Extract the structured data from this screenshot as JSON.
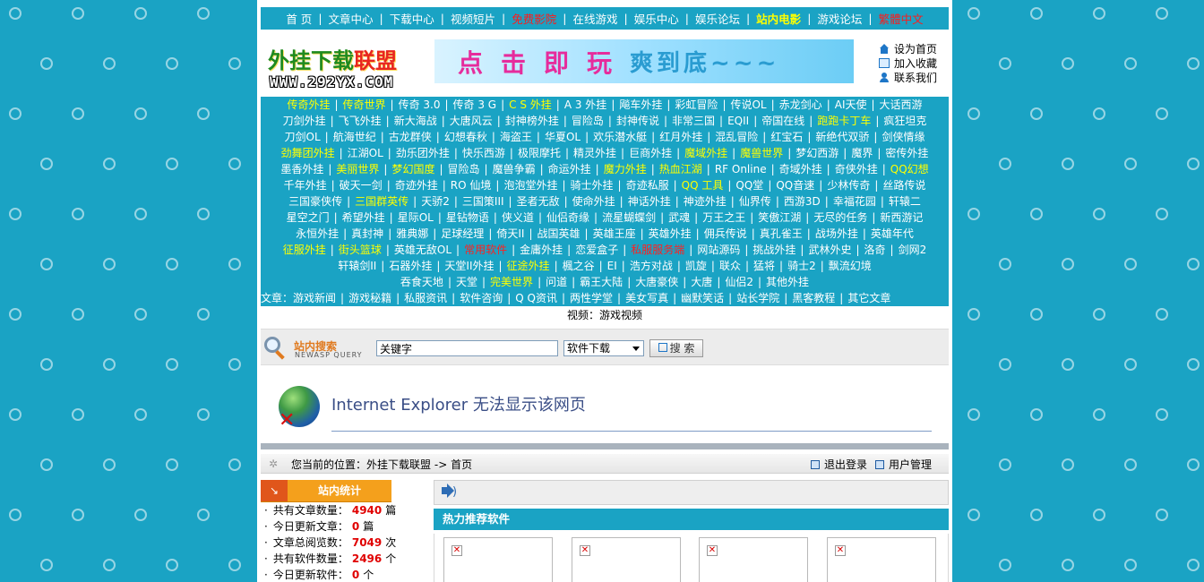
{
  "topnav": [
    {
      "label": "首 页",
      "style": "normal"
    },
    {
      "label": "文章中心",
      "style": "normal"
    },
    {
      "label": "下载中心",
      "style": "normal"
    },
    {
      "label": "视频短片",
      "style": "normal"
    },
    {
      "label": "免费影院",
      "style": "red"
    },
    {
      "label": "在线游戏",
      "style": "normal"
    },
    {
      "label": "娱乐中心",
      "style": "normal"
    },
    {
      "label": "娱乐论坛",
      "style": "normal"
    },
    {
      "label": "站内电影",
      "style": "yellow"
    },
    {
      "label": "游戏论坛",
      "style": "normal"
    },
    {
      "label": "繁體中文",
      "style": "red"
    }
  ],
  "logo": {
    "main_prefix": "外挂下载",
    "main_highlight": "联盟",
    "url_text": "WWW.292YX.COM"
  },
  "banner": {
    "text": "点击即玩",
    "tail": "爽到底~~~"
  },
  "quick_links": [
    {
      "label": "设为首页",
      "icon": "home-icon"
    },
    {
      "label": "加入收藏",
      "icon": "favorite-icon"
    },
    {
      "label": "联系我们",
      "icon": "contact-icon"
    }
  ],
  "link_rows": [
    [
      [
        "传奇外挂",
        "y"
      ],
      [
        "传奇世界",
        "y"
      ],
      [
        "传奇 3.0",
        ""
      ],
      [
        "传奇 3 G",
        ""
      ],
      [
        "C S 外挂",
        "y"
      ],
      [
        "A 3 外挂",
        ""
      ],
      [
        "飚车外挂",
        ""
      ],
      [
        "彩虹冒险",
        ""
      ],
      [
        "传说OL",
        ""
      ],
      [
        "赤龙剑心",
        ""
      ],
      [
        "AI天使",
        ""
      ],
      [
        "大话西游",
        ""
      ]
    ],
    [
      [
        "刀剑外挂",
        ""
      ],
      [
        "飞飞外挂",
        ""
      ],
      [
        "新大海战",
        ""
      ],
      [
        "大唐风云",
        ""
      ],
      [
        "封神榜外挂",
        ""
      ],
      [
        "冒险岛",
        ""
      ],
      [
        "封神传说",
        ""
      ],
      [
        "非常三国",
        ""
      ],
      [
        "EQII",
        ""
      ],
      [
        "帝国在线",
        ""
      ],
      [
        "跑跑卡丁车",
        "y"
      ],
      [
        "疯狂坦克",
        ""
      ]
    ],
    [
      [
        "刀剑OL",
        ""
      ],
      [
        "航海世纪",
        ""
      ],
      [
        "古龙群侠",
        ""
      ],
      [
        "幻想春秋",
        ""
      ],
      [
        "海盗王",
        ""
      ],
      [
        "华夏OL",
        ""
      ],
      [
        "欢乐潜水艇",
        ""
      ],
      [
        "红月外挂",
        ""
      ],
      [
        "混乱冒险",
        ""
      ],
      [
        "红宝石",
        ""
      ],
      [
        "新绝代双骄",
        ""
      ],
      [
        "剑侠情缘",
        ""
      ]
    ],
    [
      [
        "劲舞团外挂",
        "y"
      ],
      [
        "江湖OL",
        ""
      ],
      [
        "劲乐团外挂",
        ""
      ],
      [
        "快乐西游",
        ""
      ],
      [
        "极限摩托",
        ""
      ],
      [
        "精灵外挂",
        ""
      ],
      [
        "巨商外挂",
        ""
      ],
      [
        "魔域外挂",
        "y"
      ],
      [
        "魔兽世界",
        "y"
      ],
      [
        "梦幻西游",
        ""
      ],
      [
        "魔界",
        ""
      ],
      [
        "密传外挂",
        ""
      ]
    ],
    [
      [
        "墨香外挂",
        ""
      ],
      [
        "美丽世界",
        "y"
      ],
      [
        "梦幻国度",
        "y"
      ],
      [
        "冒险岛",
        ""
      ],
      [
        "魔兽争霸",
        ""
      ],
      [
        "命运外挂",
        ""
      ],
      [
        "魔力外挂",
        "y"
      ],
      [
        "热血江湖",
        "y"
      ],
      [
        "RF Online",
        ""
      ],
      [
        "奇域外挂",
        ""
      ],
      [
        "奇侠外挂",
        ""
      ],
      [
        "QQ幻想",
        "y"
      ]
    ],
    [
      [
        "千年外挂",
        ""
      ],
      [
        "破天一剑",
        ""
      ],
      [
        "奇迹外挂",
        ""
      ],
      [
        "RO 仙境",
        ""
      ],
      [
        "泡泡堂外挂",
        ""
      ],
      [
        "骑士外挂",
        ""
      ],
      [
        "奇迹私服",
        ""
      ],
      [
        "QQ 工具",
        "y"
      ],
      [
        "QQ堂",
        ""
      ],
      [
        "QQ音速",
        ""
      ],
      [
        "少林传奇",
        ""
      ],
      [
        "丝路传说",
        ""
      ]
    ],
    [
      [
        "三国豪侠传",
        ""
      ],
      [
        "三国群英传",
        "y"
      ],
      [
        "天骄2",
        ""
      ],
      [
        "三国策III",
        ""
      ],
      [
        "圣者无敌",
        ""
      ],
      [
        "使命外挂",
        ""
      ],
      [
        "神话外挂",
        ""
      ],
      [
        "神迹外挂",
        ""
      ],
      [
        "仙界传",
        ""
      ],
      [
        "西游3D",
        ""
      ],
      [
        "幸福花园",
        ""
      ],
      [
        "轩辕二",
        ""
      ]
    ],
    [
      [
        "星空之门",
        ""
      ],
      [
        "希望外挂",
        ""
      ],
      [
        "星际OL",
        ""
      ],
      [
        "星钻物语",
        ""
      ],
      [
        "侠义道",
        ""
      ],
      [
        "仙侣奇缘",
        ""
      ],
      [
        "流星蝴蝶剑",
        ""
      ],
      [
        "武魂",
        ""
      ],
      [
        "万王之王",
        ""
      ],
      [
        "笑傲江湖",
        ""
      ],
      [
        "无尽的任务",
        ""
      ],
      [
        "新西游记",
        ""
      ]
    ],
    [
      [
        "永恒外挂",
        ""
      ],
      [
        "真封神",
        ""
      ],
      [
        "雅典娜",
        ""
      ],
      [
        "足球经理",
        ""
      ],
      [
        "倚天II",
        ""
      ],
      [
        "战国英雄",
        ""
      ],
      [
        "英雄王座",
        ""
      ],
      [
        "英雄外挂",
        ""
      ],
      [
        "佣兵传说",
        ""
      ],
      [
        "真孔雀王",
        ""
      ],
      [
        "战场外挂",
        ""
      ],
      [
        "英雄年代",
        ""
      ]
    ],
    [
      [
        "征服外挂",
        "y"
      ],
      [
        "街头篮球",
        "y"
      ],
      [
        "英雄无敌OL",
        ""
      ],
      [
        "常用软件",
        "r"
      ],
      [
        "金庸外挂",
        ""
      ],
      [
        "恋爱盒子",
        ""
      ],
      [
        "私服服务端",
        "r"
      ],
      [
        "网站源码",
        ""
      ],
      [
        "挑战外挂",
        ""
      ],
      [
        "武林外史",
        ""
      ],
      [
        "洛奇",
        ""
      ],
      [
        "剑网2",
        ""
      ]
    ],
    [
      [
        "轩辕剑II",
        ""
      ],
      [
        "石器外挂",
        ""
      ],
      [
        "天堂II外挂",
        ""
      ],
      [
        "征途外挂",
        "y"
      ],
      [
        "楓之谷",
        ""
      ],
      [
        "EI",
        ""
      ],
      [
        "浩方对战",
        ""
      ],
      [
        "凯旋",
        ""
      ],
      [
        "联众",
        ""
      ],
      [
        "猛将",
        ""
      ],
      [
        "骑士2",
        ""
      ],
      [
        "飘流幻境",
        ""
      ]
    ],
    [
      [
        "吞食天地",
        ""
      ],
      [
        "天堂",
        ""
      ],
      [
        "完美世界",
        "y"
      ],
      [
        "问道",
        ""
      ],
      [
        "霸王大陆",
        ""
      ],
      [
        "大唐豪侠",
        ""
      ],
      [
        "大唐",
        ""
      ],
      [
        "仙侣2",
        ""
      ],
      [
        "其他外挂",
        ""
      ]
    ]
  ],
  "article_line": {
    "prefix": "文章：",
    "items": [
      "游戏新闻",
      "游戏秘籍",
      "私服资讯",
      "软件咨询",
      "Q Q资讯",
      "两性学堂",
      "美女写真",
      "幽默笑话",
      "站长学院",
      "黑客教程",
      "其它文章"
    ]
  },
  "video_line": {
    "prefix": "视频：",
    "item": "游戏视频"
  },
  "search": {
    "title": "站内搜索",
    "subtitle": "NEWASP QUERY",
    "keyword": "关键字",
    "category": "软件下载",
    "button": "搜 索"
  },
  "error_title": "Internet Explorer 无法显示该网页",
  "breadcrumb": {
    "prefix": "您当前的位置：",
    "site": "外挂下载联盟",
    "arrow": "->",
    "current": "首页",
    "logout": "退出登录",
    "user_manage": "用户管理"
  },
  "stats": {
    "title": "站内统计",
    "items": [
      {
        "label": "共有文章数量：",
        "value": "4940",
        "unit": "篇"
      },
      {
        "label": "今日更新文章：",
        "value": "0",
        "unit": "篇"
      },
      {
        "label": "文章总阅览数：",
        "value": "7049",
        "unit": "次"
      },
      {
        "label": "共有软件数量：",
        "value": "2496",
        "unit": "个"
      },
      {
        "label": "今日更新软件：",
        "value": "0",
        "unit": "个"
      }
    ]
  },
  "hot_title": "热力推荐软件",
  "colors": {
    "background": "#1aa3c4",
    "accent_yellow": "#ffff00",
    "accent_red": "#ff1a1a",
    "stats_orange": "#f4a01c"
  }
}
